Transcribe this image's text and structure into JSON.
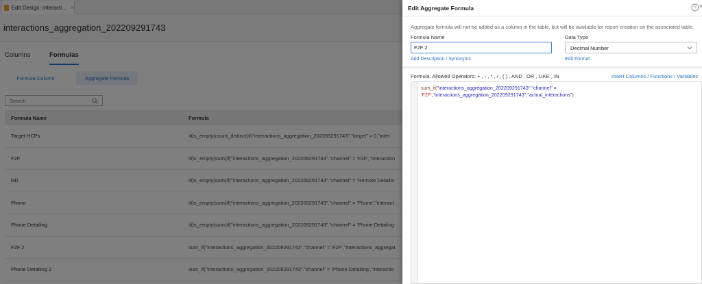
{
  "browser_tab": {
    "label": "Edit Design: interacti...",
    "close": "×"
  },
  "page_title": "interactions_aggregation_202209291743",
  "sub_tabs": [
    {
      "label": "Columns"
    },
    {
      "label": "Formulas"
    }
  ],
  "formula_types": [
    {
      "label": "Formula Column"
    },
    {
      "label": "Aggregate Formula"
    }
  ],
  "search": {
    "placeholder": "Search"
  },
  "table": {
    "headers": {
      "name": "Formula Name",
      "formula": "Formula"
    },
    "rows": [
      {
        "name": "Target HCPs",
        "formula": "if(is_empty(count_distinct(if(\"interactions_aggregation_202209291743\".\"target\" > 0,\"inter"
      },
      {
        "name": "F2F",
        "formula": "if(is_empty(sum(if(\"interactions_aggregation_202209291743\".\"channel\" = 'F2F',\"interaction"
      },
      {
        "name": "RD",
        "formula": "if(is_empty(sum(if(\"interactions_aggregation_202209291743\".\"channel\" = 'Remote Detailin"
      },
      {
        "name": "Phone",
        "formula": "if(is_empty(sum(if(\"interactions_aggregation_202209291743\".\"channel\" = 'Phone',\"interact"
      },
      {
        "name": "Phone Detailing",
        "formula": "if(is_empty(sum(if(\"interactions_aggregation_202209291743\".\"channel\" = 'Phone Detailing"
      },
      {
        "name": "F2F 2",
        "formula": "sum_if(\"interactions_aggregation_202209291743\".\"channel\" = 'F2F',\"interactions_aggregat"
      },
      {
        "name": "Phone Detailing 2",
        "formula": "sum_if(\"interactions_aggregation_202209291743\".\"channel\" = 'Phone Detailing',\"interactio"
      }
    ]
  },
  "dialog": {
    "title": "Edit Aggregate Formula",
    "help": "?",
    "close": "×",
    "info": "Aggregate formula will not be added as a column in the table, but will be available for report creation on the associated table.",
    "formula_name_label": "Formula Name",
    "formula_name_value": "F2F 2",
    "add_description_link": "Add Description / Synonyms",
    "data_type_label": "Data Type",
    "data_type_value": "Decimal Number",
    "edit_format_link": "Edit Format",
    "operators_label": "Formula: Allowed Operators: + , - , * , / , ( ) , AND , OR , LIKE , IN",
    "insert_link": "Insert Columns / Functions / Variables",
    "code": {
      "fn": "sum_if(",
      "table1": "\"interactions_aggregation_202209291743\"",
      "col1": ".\"channel\"",
      "eq": " =",
      "literal": "'F2F'",
      "comma": ",",
      "table2": "\"interactions_aggregation_202209291743\"",
      "col2": ".\"actual_interactions\"",
      "close": ")"
    }
  }
}
